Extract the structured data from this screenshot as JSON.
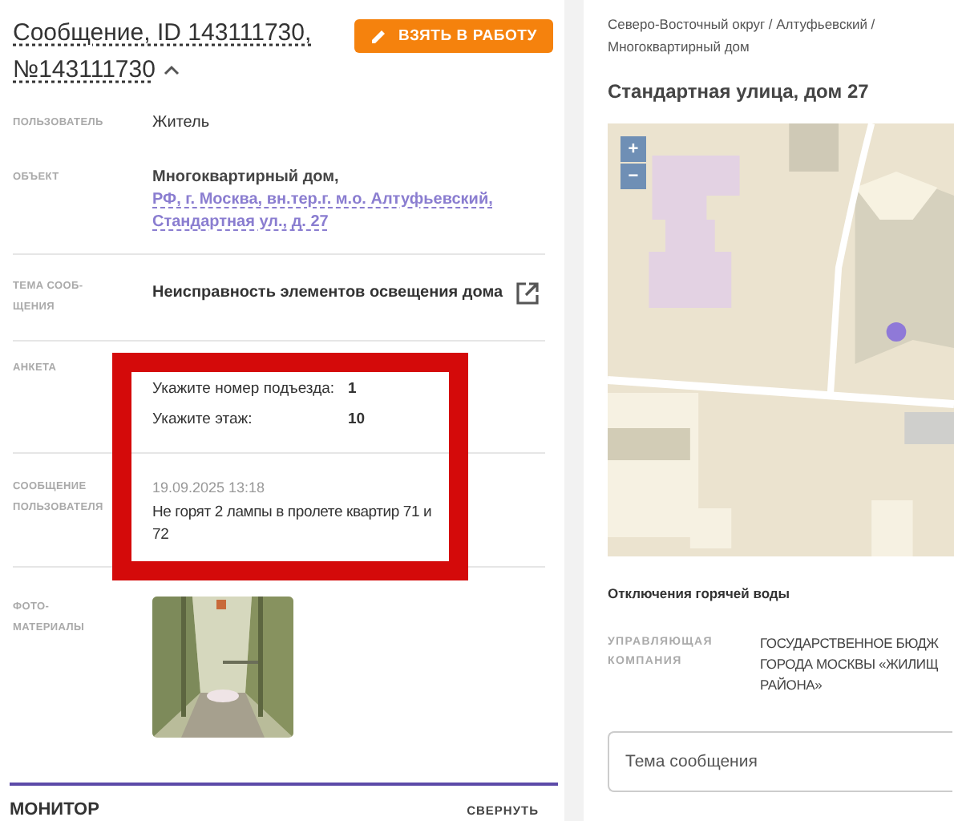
{
  "header": {
    "title_line1": "Сообщение, ID 143111730,",
    "title_line2": "№143111730",
    "expanded": true,
    "action_button": "ВЗЯТЬ В РАБОТУ"
  },
  "fields": [
    {
      "kind": "text",
      "label": "ПОЛЬЗОВАТЕЛЬ",
      "value": "Житель"
    },
    {
      "kind": "object",
      "label": "ОБЪЕКТ",
      "value": "Многоквартирный дом,",
      "link": "РФ, г. Москва, вн.тер.г. м.о. Алтуфьевский, Стандартная ул., д. 27"
    },
    {
      "kind": "topic",
      "label": "ТЕМА СООБ-ЩЕНИЯ",
      "value": "Неисправность элементов освещения дома"
    },
    {
      "kind": "survey",
      "label": "АНКЕТА",
      "answers": [
        {
          "question": "Укажите номер подъезда:",
          "answer": "1"
        },
        {
          "question": "Укажите этаж:",
          "answer": "10"
        }
      ]
    },
    {
      "kind": "message",
      "label": "СООБЩЕНИЕ ПОЛЬЗОВАТЕЛЯ",
      "date": "19.09.2025 13:18",
      "value": "Не горят 2 лампы в пролете квартир 71 и 72"
    },
    {
      "label": "ФОТО-МАТЕРИАЛЫ"
    }
  ],
  "monitor": {
    "title": "МОНИТОР",
    "toggle": "СВЕРНУТЬ"
  },
  "right": {
    "breadcrumb": "Северо-Восточный округ / Алтуфьевский / Многоквартирный дом",
    "address": "Стандартная улица, дом 27",
    "map": {
      "kind": "picture",
      "zoom_in": "+",
      "zoom_out": "−"
    },
    "outages": "Отключения горячей воды",
    "company_label": "УПРАВЛЯЮЩАЯ КОМПАНИЯ",
    "company_lines": [
      "ГОСУДАРСТВЕННОЕ БЮДЖ",
      "ГОРОДА МОСКВЫ «ЖИЛИЩ",
      "РАЙОНА»"
    ],
    "subject": {
      "placeholder": "Тема сообщения"
    }
  }
}
